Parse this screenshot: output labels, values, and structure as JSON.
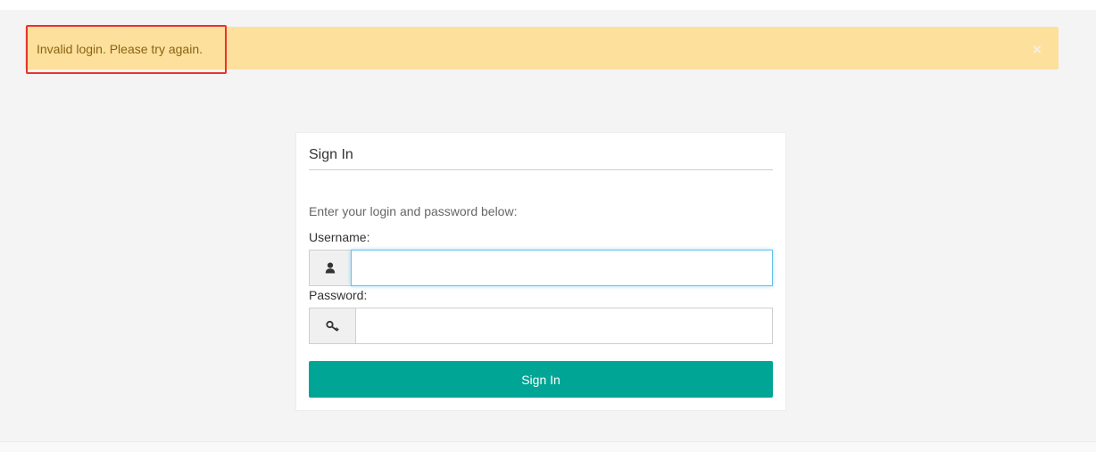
{
  "alert": {
    "message": "Invalid login. Please try again.",
    "close_symbol": "×",
    "close_icon": "close-icon"
  },
  "login": {
    "title": "Sign In",
    "instructions": "Enter your login and password below:",
    "username": {
      "label": "Username:",
      "value": "",
      "icon": "user-icon"
    },
    "password": {
      "label": "Password:",
      "value": "",
      "icon": "key-icon"
    },
    "submit_label": "Sign In"
  },
  "colors": {
    "alert_background": "#fde09c",
    "alert_text": "#8a6313",
    "highlight_border": "#e8342b",
    "button_background": "#00a595",
    "focus_border": "#66c0ea"
  }
}
